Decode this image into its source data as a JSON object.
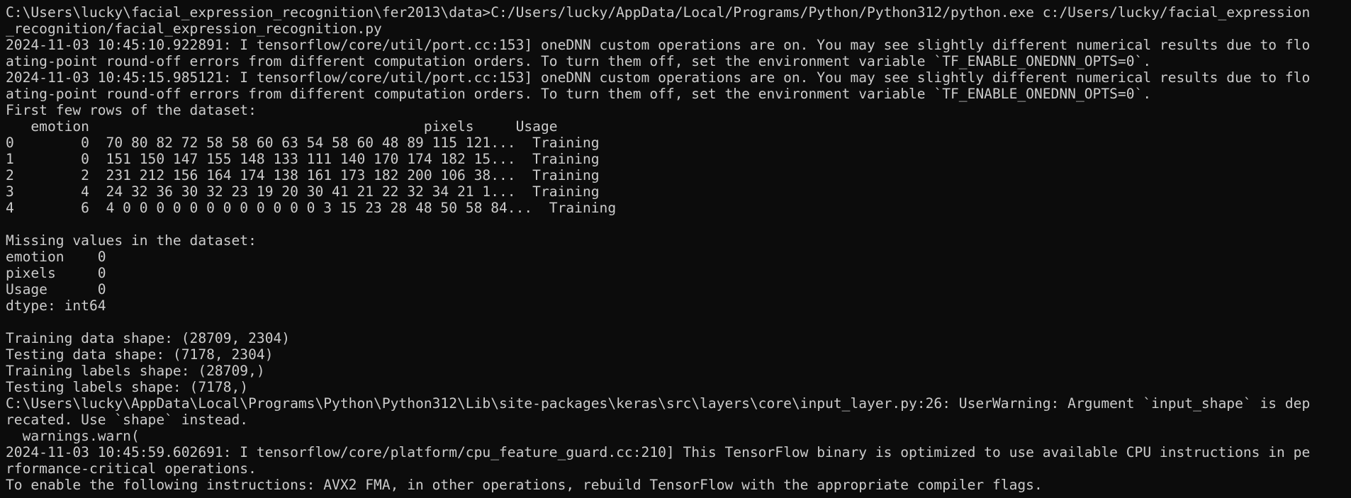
{
  "terminal": {
    "lines": [
      "C:\\Users\\lucky\\facial_expression_recognition\\fer2013\\data>C:/Users/lucky/AppData/Local/Programs/Python/Python312/python.exe c:/Users/lucky/facial_expression",
      "_recognition/facial_expression_recognition.py",
      "2024-11-03 10:45:10.922891: I tensorflow/core/util/port.cc:153] oneDNN custom operations are on. You may see slightly different numerical results due to flo",
      "ating-point round-off errors from different computation orders. To turn them off, set the environment variable `TF_ENABLE_ONEDNN_OPTS=0`.",
      "2024-11-03 10:45:15.985121: I tensorflow/core/util/port.cc:153] oneDNN custom operations are on. You may see slightly different numerical results due to flo",
      "ating-point round-off errors from different computation orders. To turn them off, set the environment variable `TF_ENABLE_ONEDNN_OPTS=0`.",
      "First few rows of the dataset:",
      "   emotion                                        pixels     Usage",
      "0        0  70 80 82 72 58 58 60 63 54 58 60 48 89 115 121...  Training",
      "1        0  151 150 147 155 148 133 111 140 170 174 182 15...  Training",
      "2        2  231 212 156 164 174 138 161 173 182 200 106 38...  Training",
      "3        4  24 32 36 30 32 23 19 20 30 41 21 22 32 34 21 1...  Training",
      "4        6  4 0 0 0 0 0 0 0 0 0 0 0 0 3 15 23 28 48 50 58 84...  Training",
      "",
      "Missing values in the dataset:",
      "emotion    0",
      "pixels     0",
      "Usage      0",
      "dtype: int64",
      "",
      "Training data shape: (28709, 2304)",
      "Testing data shape: (7178, 2304)",
      "Training labels shape: (28709,)",
      "Testing labels shape: (7178,)",
      "C:\\Users\\lucky\\AppData\\Local\\Programs\\Python\\Python312\\Lib\\site-packages\\keras\\src\\layers\\core\\input_layer.py:26: UserWarning: Argument `input_shape` is dep",
      "recated. Use `shape` instead.",
      "  warnings.warn(",
      "2024-11-03 10:45:59.602691: I tensorflow/core/platform/cpu_feature_guard.cc:210] This TensorFlow binary is optimized to use available CPU instructions in pe",
      "rformance-critical operations.",
      "To enable the following instructions: AVX2 FMA, in other operations, rebuild TensorFlow with the appropriate compiler flags."
    ]
  },
  "colors": {
    "background": "#0c0c0c",
    "foreground": "#cccccc"
  }
}
